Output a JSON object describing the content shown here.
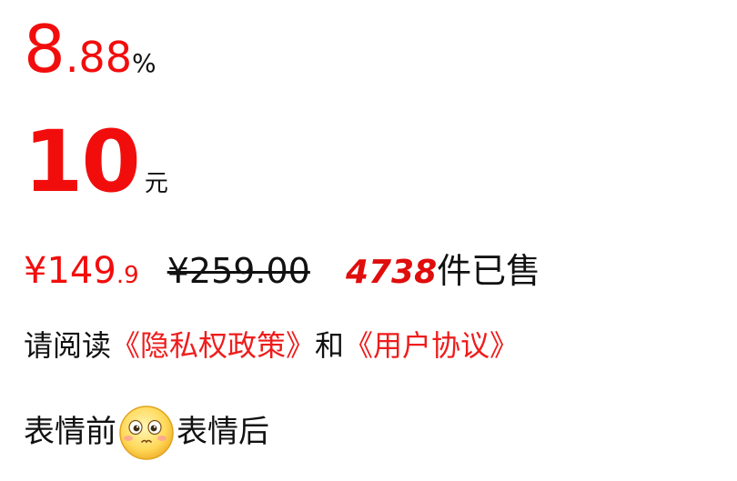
{
  "rate": {
    "integer": "8",
    "decimal": ".88",
    "unit": "%"
  },
  "amount": {
    "value": "10",
    "unit": "元"
  },
  "price": {
    "currency": "¥",
    "integer": "149",
    "decimal": ".9",
    "original": "¥259.00",
    "sold_count": "4738",
    "sold_label": "件已售"
  },
  "agreement": {
    "prefix": "请阅读",
    "privacy_link": "《隐私权政策》",
    "connector": "和",
    "user_link": "《用户协议》"
  },
  "emoji_line": {
    "before": "表情前",
    "emoji_icon": "blushing-face-icon",
    "after": "表情后"
  },
  "colors": {
    "accent_red": "#f20d0d",
    "link_red": "#ef1c1c",
    "text": "#111111"
  }
}
